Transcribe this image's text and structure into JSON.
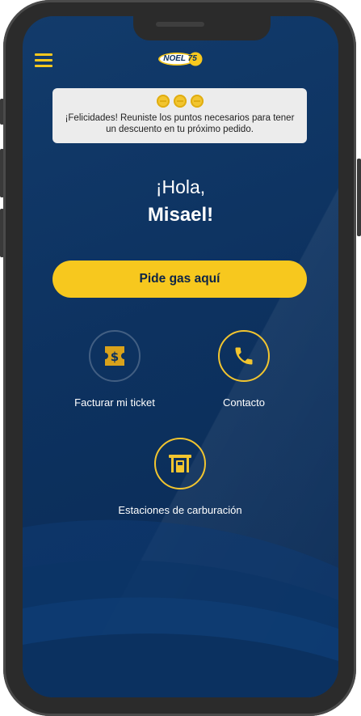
{
  "header": {
    "menu_icon": "hamburger-menu-icon",
    "logo_text": "NOEL 75"
  },
  "notice": {
    "coin_count": 3,
    "coin_icon": "points-coin-icon",
    "message": "¡Felicidades! Reuniste los puntos necesarios para tener un descuento en tu próximo pedido."
  },
  "greeting": {
    "hello": "¡Hola,",
    "name": "Misael!"
  },
  "order_button": {
    "label": "Pide gas aquí"
  },
  "actions": {
    "invoice": {
      "label": "Facturar mi ticket",
      "icon": "ticket-dollar-icon"
    },
    "contact": {
      "label": "Contacto",
      "icon": "phone-icon"
    },
    "stations": {
      "label": "Estaciones de carburación",
      "icon": "gas-station-icon"
    }
  },
  "colors": {
    "background": "#0d3260",
    "accent": "#f7c81e",
    "notice_bg": "#ececec",
    "text_light": "#ffffff"
  }
}
